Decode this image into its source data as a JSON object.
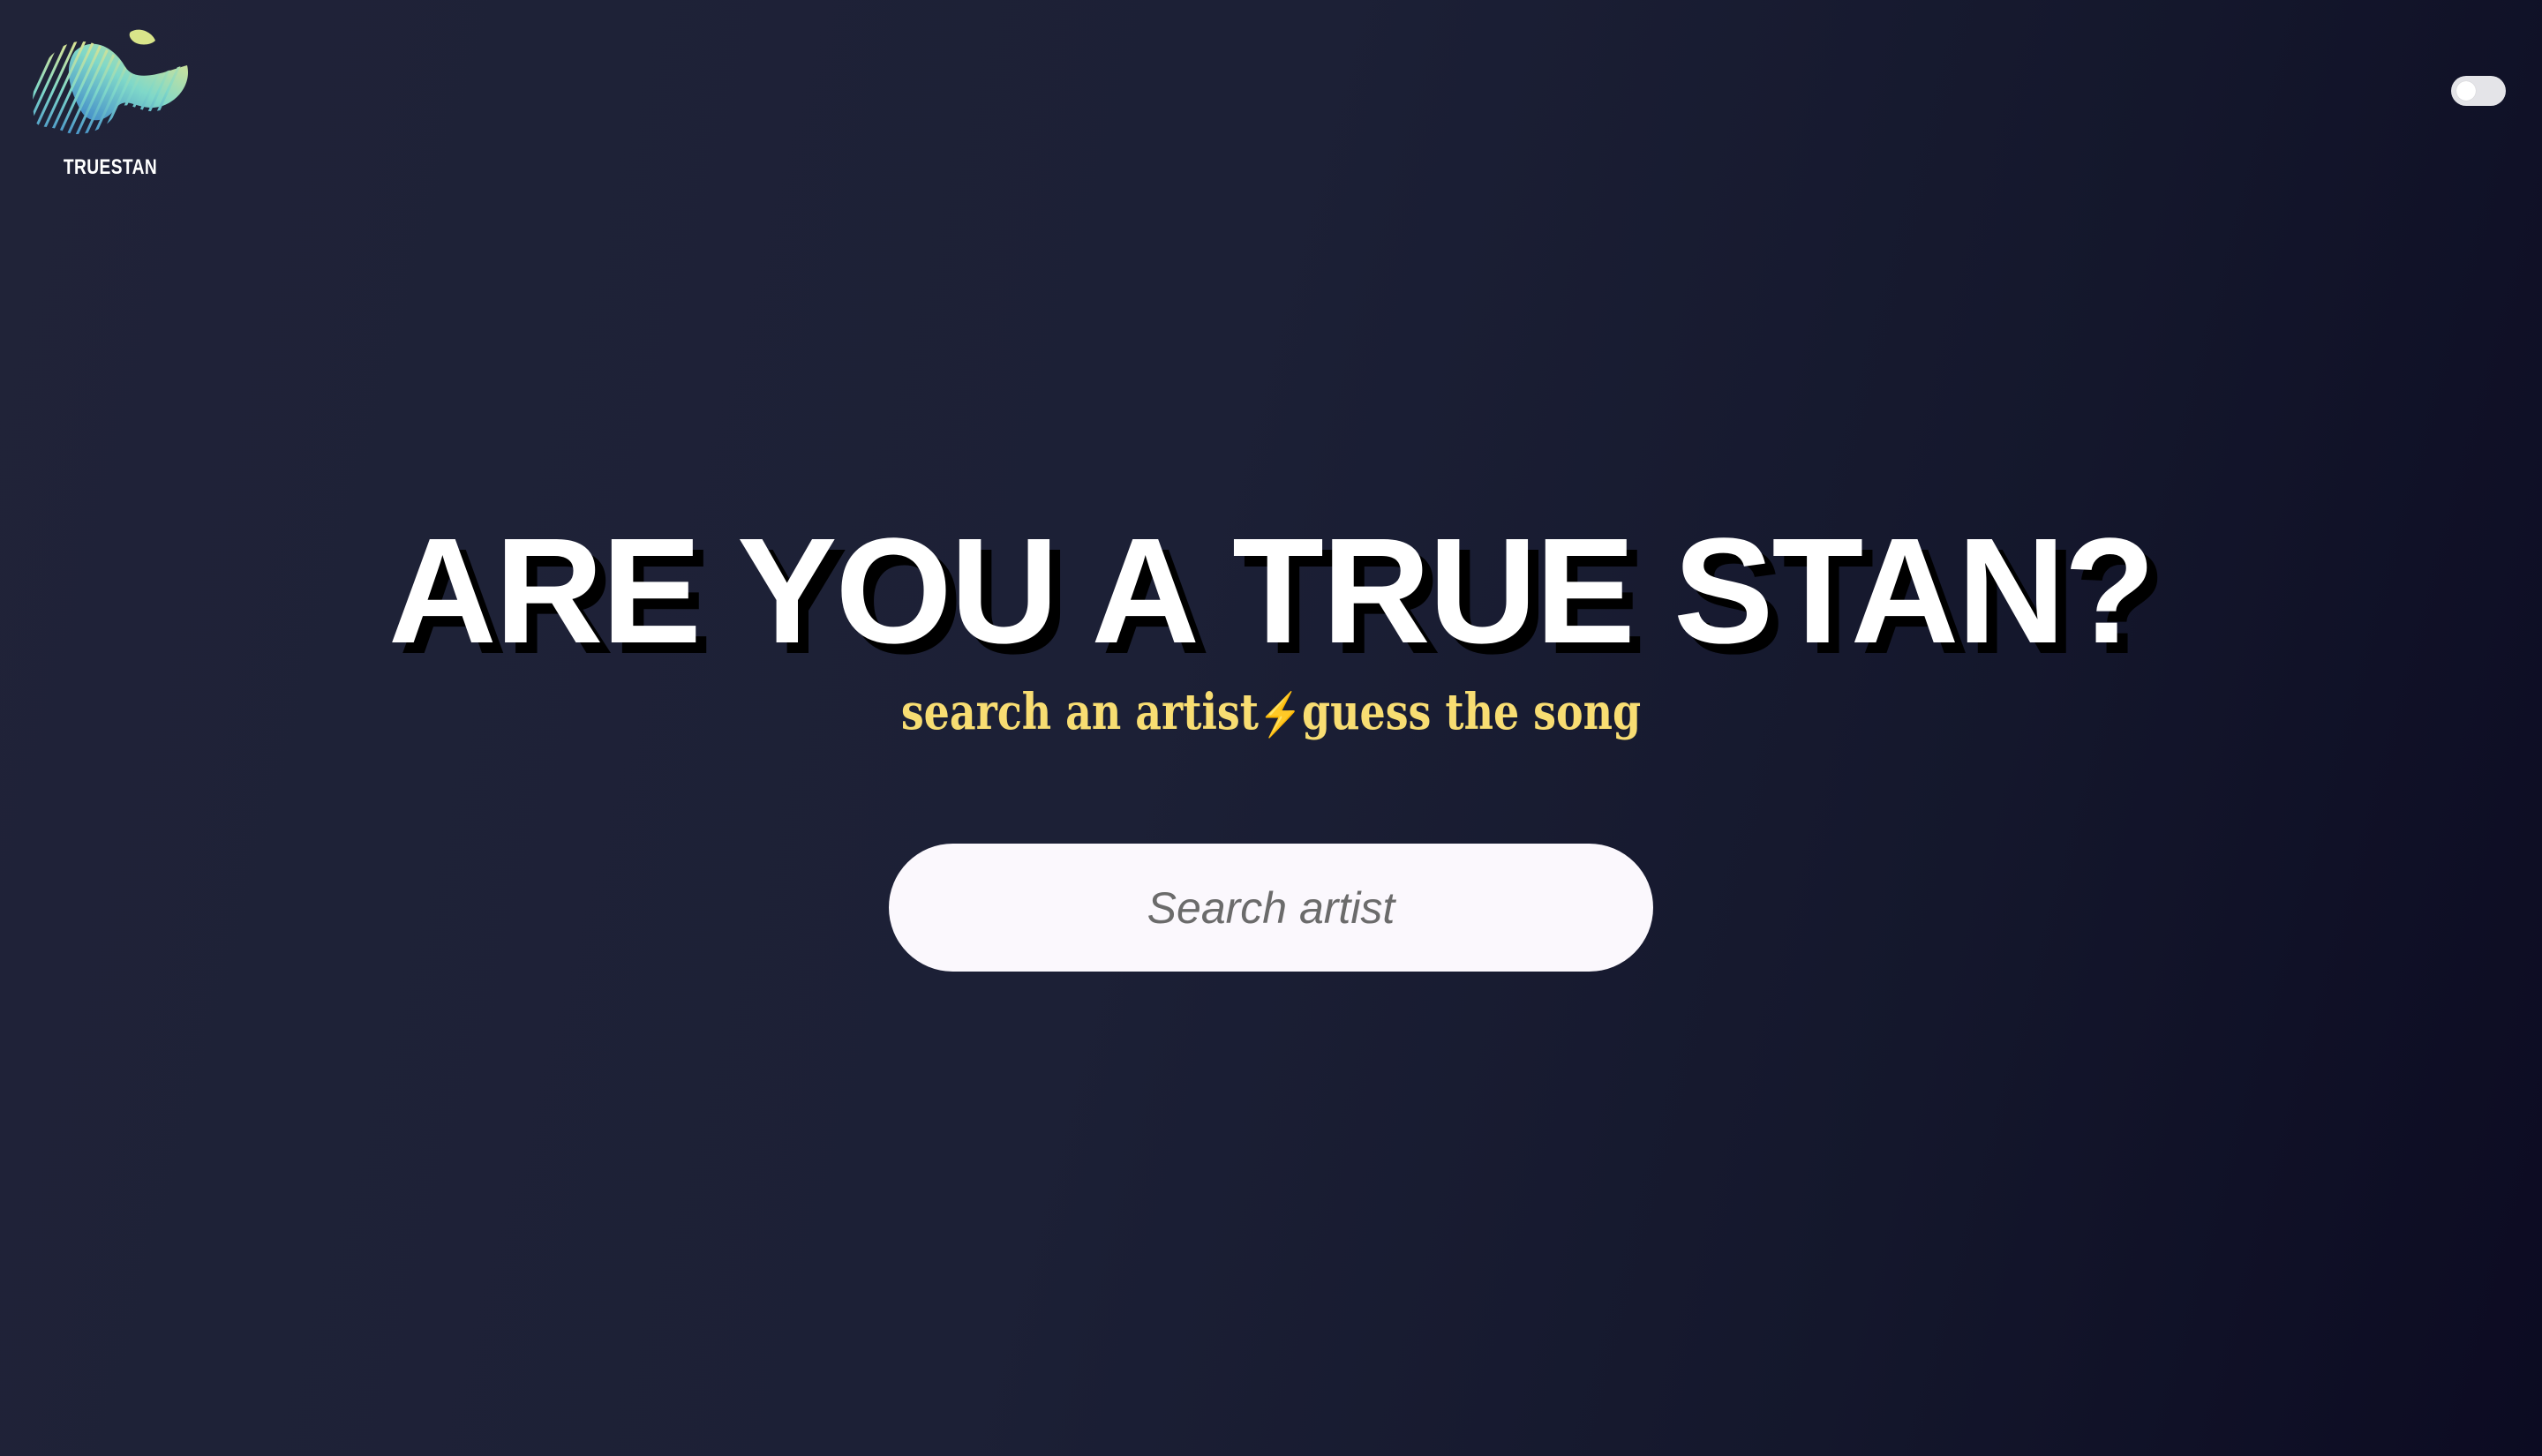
{
  "brand": {
    "name": "TRUESTAN",
    "logo_icon": "truestan-wave-logo-icon"
  },
  "theme_toggle": {
    "icon": "theme-toggle-switch",
    "state": "off"
  },
  "hero": {
    "headline": "ARE YOU A TRUE STAN?",
    "tagline_part1": "search an artist",
    "tagline_separator": "⚡",
    "tagline_part2": "guess the song"
  },
  "search": {
    "placeholder": "Search artist",
    "value": ""
  },
  "colors": {
    "background_start": "#202338",
    "background_end": "#0c0b22",
    "headline": "#ffffff",
    "headline_shadow": "#000000",
    "tagline": "#f8dd72",
    "search_background": "#fbf8fd"
  }
}
